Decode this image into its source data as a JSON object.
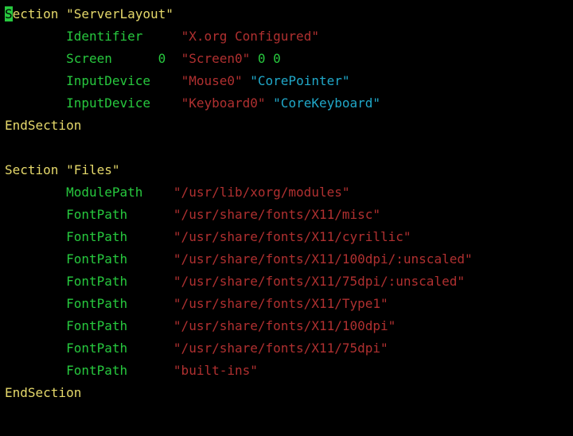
{
  "sections": [
    {
      "kw_open": "Section",
      "name": "\"ServerLayout\"",
      "entries": [
        {
          "dir": "Identifier",
          "pad": 5,
          "args": [
            {
              "t": "\"X.org Configured\"",
              "c": "str"
            }
          ]
        },
        {
          "dir": "Screen",
          "pad": 6,
          "pre_num": "0",
          "args": [
            {
              "t": "\"Screen0\"",
              "c": "str"
            },
            {
              "t": " 0 0",
              "c": "num"
            }
          ]
        },
        {
          "dir": "InputDevice",
          "pad": 4,
          "args": [
            {
              "t": "\"Mouse0\"",
              "c": "str"
            },
            {
              "t": " ",
              "c": ""
            },
            {
              "t": "\"CorePointer\"",
              "c": "str2"
            }
          ]
        },
        {
          "dir": "InputDevice",
          "pad": 4,
          "args": [
            {
              "t": "\"Keyboard0\"",
              "c": "str"
            },
            {
              "t": " ",
              "c": ""
            },
            {
              "t": "\"CoreKeyboard\"",
              "c": "str2"
            }
          ]
        }
      ],
      "kw_close": "EndSection"
    },
    {
      "kw_open": "Section",
      "name": "\"Files\"",
      "entries": [
        {
          "dir": "ModulePath",
          "pad": 4,
          "args": [
            {
              "t": "\"/usr/lib/xorg/modules\"",
              "c": "str"
            }
          ]
        },
        {
          "dir": "FontPath",
          "pad": 6,
          "args": [
            {
              "t": "\"/usr/share/fonts/X11/misc\"",
              "c": "str"
            }
          ]
        },
        {
          "dir": "FontPath",
          "pad": 6,
          "args": [
            {
              "t": "\"/usr/share/fonts/X11/cyrillic\"",
              "c": "str"
            }
          ]
        },
        {
          "dir": "FontPath",
          "pad": 6,
          "args": [
            {
              "t": "\"/usr/share/fonts/X11/100dpi/:unscaled\"",
              "c": "str"
            }
          ]
        },
        {
          "dir": "FontPath",
          "pad": 6,
          "args": [
            {
              "t": "\"/usr/share/fonts/X11/75dpi/:unscaled\"",
              "c": "str"
            }
          ]
        },
        {
          "dir": "FontPath",
          "pad": 6,
          "args": [
            {
              "t": "\"/usr/share/fonts/X11/Type1\"",
              "c": "str"
            }
          ]
        },
        {
          "dir": "FontPath",
          "pad": 6,
          "args": [
            {
              "t": "\"/usr/share/fonts/X11/100dpi\"",
              "c": "str"
            }
          ]
        },
        {
          "dir": "FontPath",
          "pad": 6,
          "args": [
            {
              "t": "\"/usr/share/fonts/X11/75dpi\"",
              "c": "str"
            }
          ]
        },
        {
          "dir": "FontPath",
          "pad": 6,
          "args": [
            {
              "t": "\"built-ins\"",
              "c": "str"
            }
          ]
        }
      ],
      "kw_close": "EndSection"
    }
  ],
  "indent": "        ",
  "cursor": {
    "section": 0,
    "char": 0
  }
}
